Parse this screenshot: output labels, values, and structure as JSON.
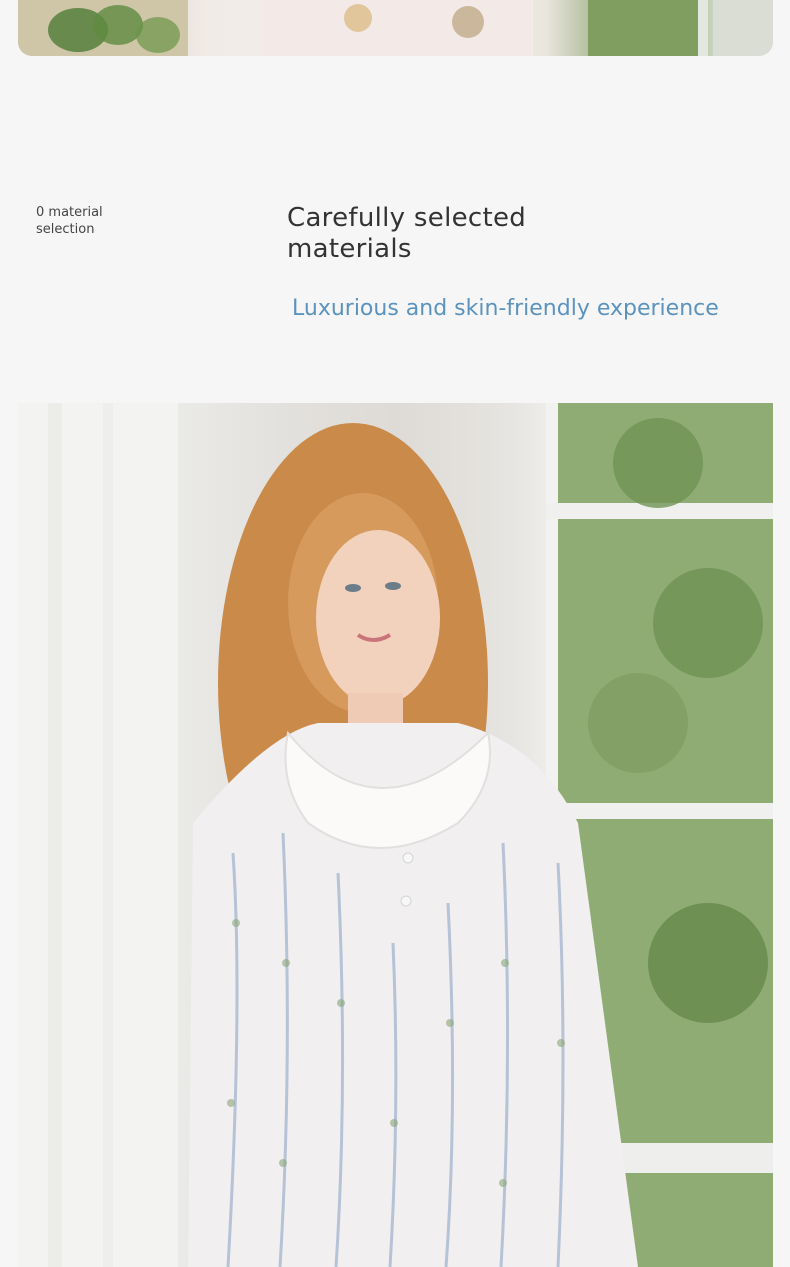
{
  "top_image": {
    "alt_icon": "pajama-product-photo"
  },
  "section": {
    "tag": "0 material\nselection",
    "title": "Carefully selected\nmaterials",
    "subtitle": "Luxurious and skin-friendly experience"
  },
  "main_photo": {
    "alt_icon": "model-wearing-floral-nightgown-photo"
  }
}
